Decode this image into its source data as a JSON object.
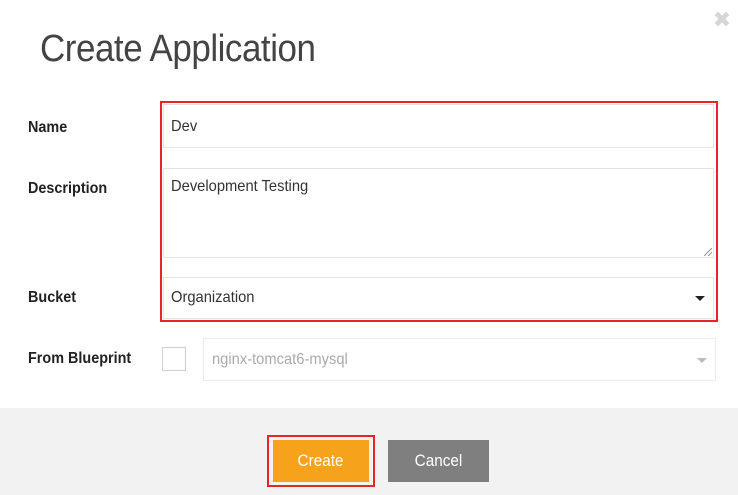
{
  "dialog": {
    "title": "Create Application",
    "close_glyph": "✖"
  },
  "form": {
    "name": {
      "label": "Name",
      "value": "Dev"
    },
    "description": {
      "label": "Description",
      "value": "Development Testing"
    },
    "bucket": {
      "label": "Bucket",
      "value": "Organization"
    },
    "blueprint": {
      "label": "From Blueprint",
      "checked": false,
      "value": "nginx-tomcat6-mysql"
    }
  },
  "buttons": {
    "create": "Create",
    "cancel": "Cancel"
  },
  "colors": {
    "accent": "#f7a21b",
    "cancel": "#7f7f7f",
    "highlight": "#e52629"
  }
}
